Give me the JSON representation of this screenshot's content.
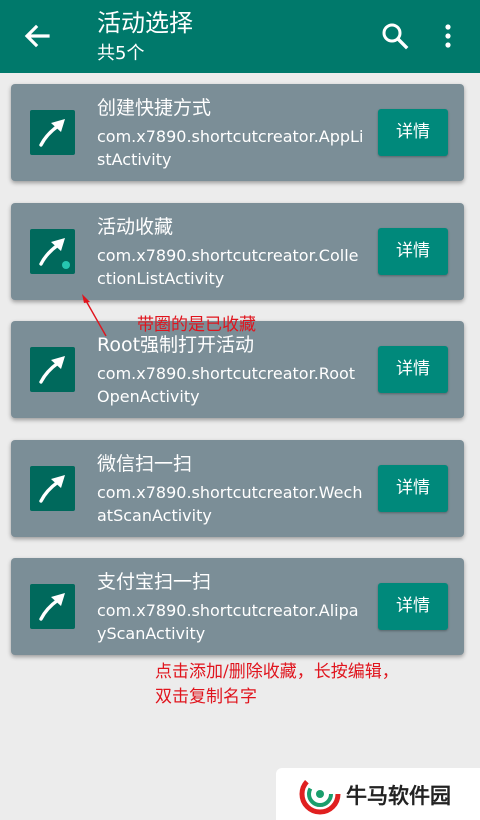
{
  "appbar": {
    "title": "活动选择",
    "subtitle": "共5个",
    "back_icon": "arrow-left-icon",
    "search_icon": "search-icon",
    "more_icon": "more-vert-icon"
  },
  "activities": [
    {
      "name": "创建快捷方式",
      "class": "com.x7890.shortcutcreator.AppListActivity",
      "favorite": false,
      "detail_label": "详情"
    },
    {
      "name": "活动收藏",
      "class": "com.x7890.shortcutcreator.CollectionListActivity",
      "favorite": true,
      "detail_label": "详情"
    },
    {
      "name": "Root强制打开活动",
      "class": "com.x7890.shortcutcreator.RootOpenActivity",
      "favorite": false,
      "detail_label": "详情"
    },
    {
      "name": "微信扫一扫",
      "class": "com.x7890.shortcutcreator.WechatScanActivity",
      "favorite": false,
      "detail_label": "详情"
    },
    {
      "name": "支付宝扫一扫",
      "class": "com.x7890.shortcutcreator.AlipayScanActivity",
      "favorite": false,
      "detail_label": "详情"
    }
  ],
  "annotations": {
    "favorite_note": "带圈的是已收藏",
    "usage_line1": "点击添加/删除收藏，长按编辑，",
    "usage_line2": "双击复制名字"
  },
  "watermark": {
    "text": "牛马软件园"
  },
  "colors": {
    "primary": "#00796b",
    "card": "#7b8e97",
    "button": "#00897b",
    "annotation": "#e0141d"
  }
}
